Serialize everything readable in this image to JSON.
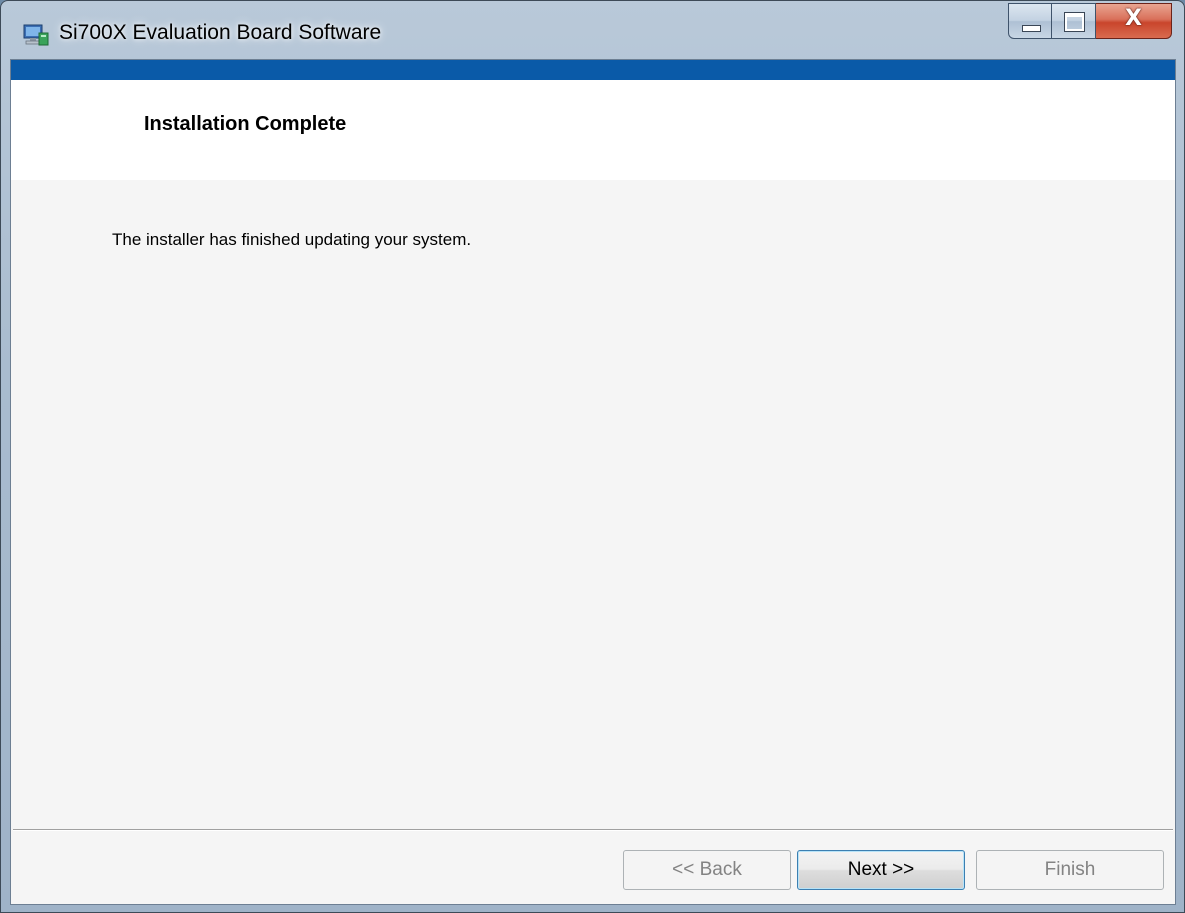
{
  "window": {
    "title": "Si700X Evaluation Board Software",
    "app_icon": "installer-computer-icon",
    "caption_buttons": {
      "minimize_icon": "minimize-icon",
      "maximize_icon": "maximize-icon",
      "close_glyph": "X"
    }
  },
  "header": {
    "title": "Installation Complete"
  },
  "body": {
    "message": "The installer has finished updating your system."
  },
  "buttons": {
    "back": {
      "label": "<< Back",
      "enabled": false
    },
    "next": {
      "label": "Next >>",
      "enabled": true,
      "default": true
    },
    "finish": {
      "label": "Finish",
      "enabled": false
    }
  },
  "colors": {
    "accent_bar": "#0a5aa8",
    "banner": "#ffffff",
    "content_bg": "#f5f5f5",
    "close_button": "#c9452c"
  }
}
